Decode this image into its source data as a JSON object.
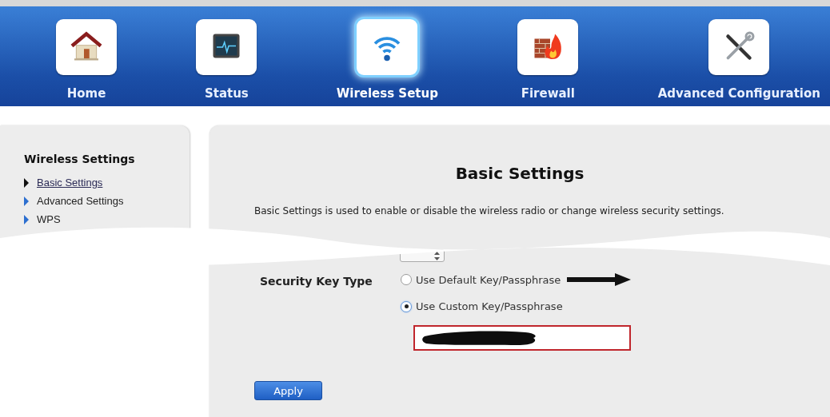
{
  "nav": [
    {
      "label": "Home",
      "kind": "home",
      "selected": false
    },
    {
      "label": "Status",
      "kind": "status",
      "selected": false
    },
    {
      "label": "Wireless Setup",
      "kind": "wireless",
      "selected": true
    },
    {
      "label": "Firewall",
      "kind": "firewall",
      "selected": false
    },
    {
      "label": "Advanced Configuration",
      "kind": "tools",
      "selected": false
    }
  ],
  "sidebar": {
    "title": "Wireless Settings",
    "items": [
      {
        "label": "Basic Settings",
        "selected": true
      },
      {
        "label": "Advanced Settings",
        "selected": false
      },
      {
        "label": "WPS",
        "selected": false
      }
    ]
  },
  "main": {
    "title": "Basic Settings",
    "description": "Basic Settings is used to enable or disable the wireless radio or change wireless security settings.",
    "security_key_type": {
      "label": "Security Key Type",
      "options": [
        {
          "label": "Use Default Key/Passphrase",
          "selected": false
        },
        {
          "label": "Use Custom Key/Passphrase",
          "selected": true
        }
      ]
    },
    "apply": "Apply"
  }
}
